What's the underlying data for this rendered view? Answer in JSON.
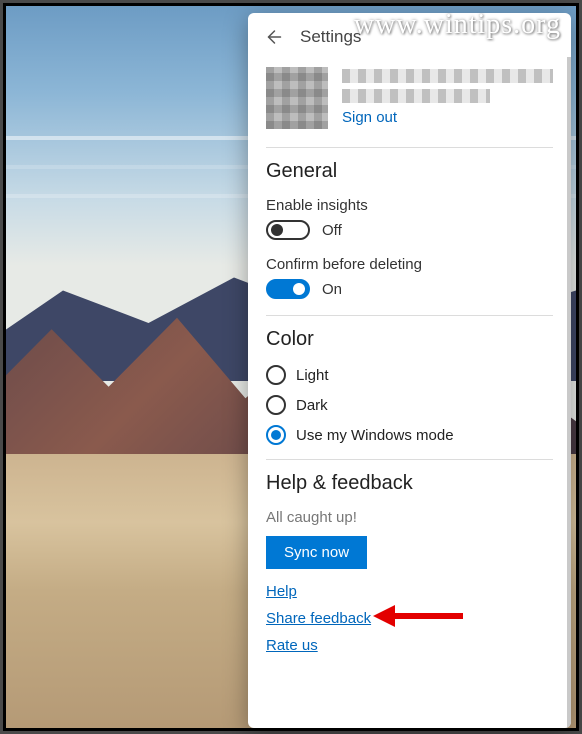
{
  "watermark": "www.wintips.org",
  "header": {
    "title": "Settings"
  },
  "account": {
    "sign_out_label": "Sign out"
  },
  "general": {
    "heading": "General",
    "insights_label": "Enable insights",
    "insights_state": "Off",
    "confirm_label": "Confirm before deleting",
    "confirm_state": "On"
  },
  "color": {
    "heading": "Color",
    "options": {
      "light": "Light",
      "dark": "Dark",
      "windows": "Use my Windows mode"
    }
  },
  "help": {
    "heading": "Help & feedback",
    "status": "All caught up!",
    "sync_button": "Sync now",
    "links": {
      "help": "Help",
      "share": "Share feedback",
      "rate": "Rate us"
    }
  }
}
